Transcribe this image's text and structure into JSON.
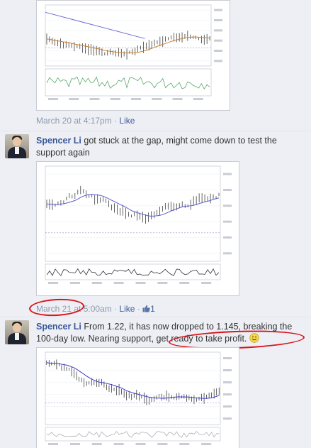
{
  "comments": [
    {
      "timestamp": "March 20 at 4:17pm",
      "separator": "·",
      "like_label": "Like"
    },
    {
      "author": "Spencer Li",
      "body": " got stuck at the gap, might come down to test the support again",
      "timestamp": "March 21 at 5:00am",
      "separator": "·",
      "like_label": "Like",
      "like_count": "1"
    },
    {
      "author": "Spencer Li",
      "body_before": " From 1.22, it has now dropped to 1.145, breaking the 100-day low. Nearing support, ",
      "body_highlight": "get ready to take profit.",
      "emoticon": "smiley-emoticon"
    }
  ],
  "colors": {
    "link": "#3b5998",
    "meta": "#8f9aaf",
    "annotation": "#d9141a",
    "background": "#edeff4"
  },
  "icons": [
    "thumbs-up-icon",
    "smiley-emoticon"
  ]
}
